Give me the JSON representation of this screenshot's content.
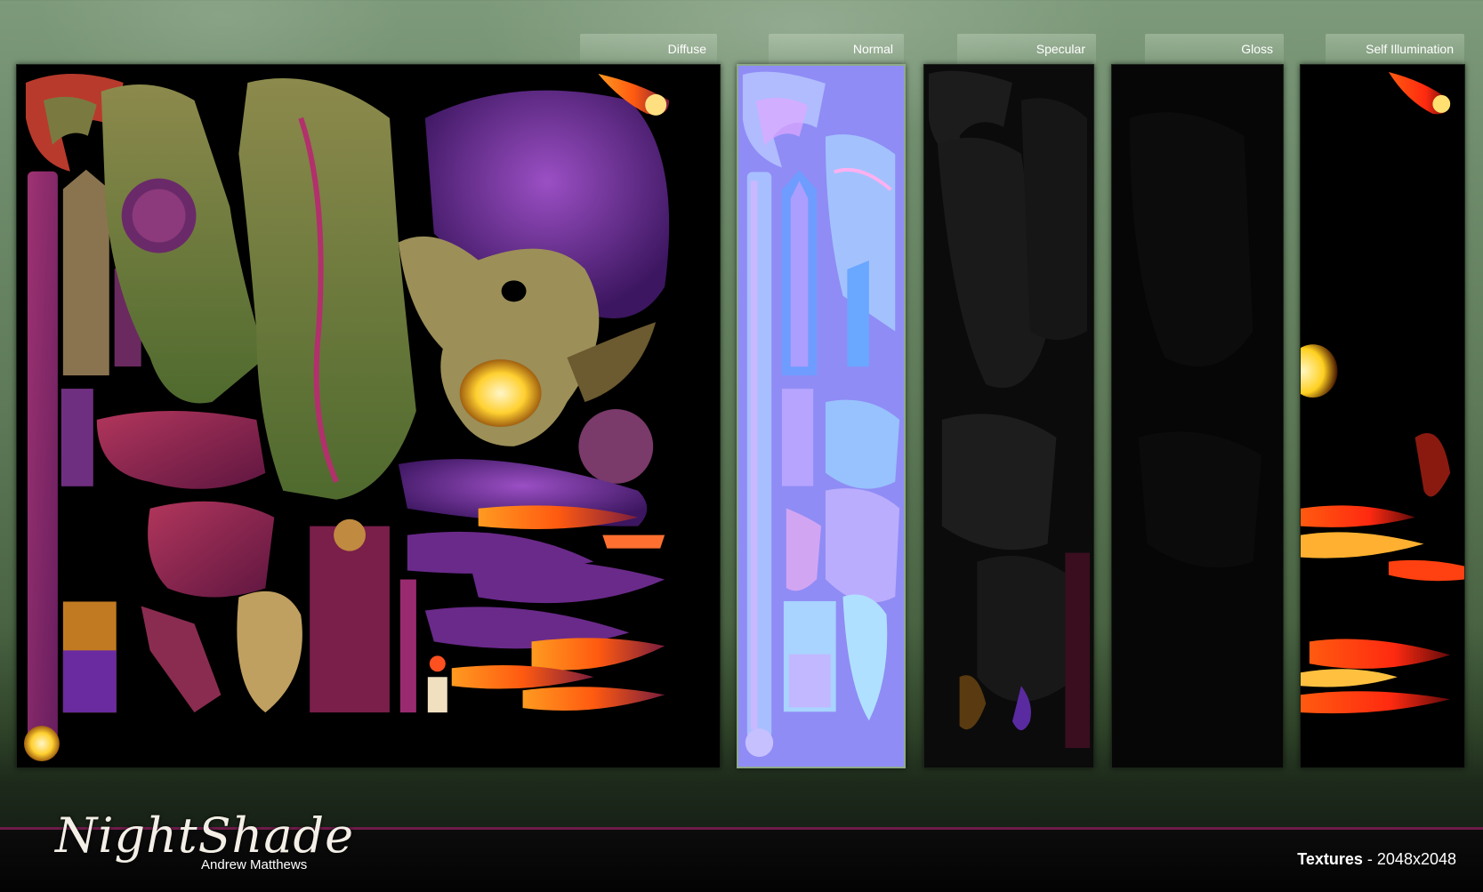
{
  "tabs": [
    {
      "label": "Diffuse"
    },
    {
      "label": "Normal"
    },
    {
      "label": "Specular"
    },
    {
      "label": "Gloss"
    },
    {
      "label": "Self Illumination"
    }
  ],
  "logo": {
    "title": "NightShade",
    "author": "Andrew Matthews"
  },
  "footer": {
    "label": "Textures",
    "separator": " - ",
    "resolution": "2048x2048"
  },
  "colors": {
    "accent_bar": "#6d1c4a",
    "normal_map_base": "#8f8cf5"
  }
}
